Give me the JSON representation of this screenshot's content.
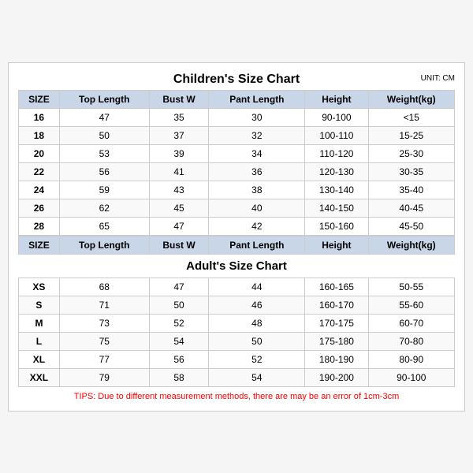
{
  "title": "Children's Size Chart",
  "unit": "UNIT: CM",
  "children_headers": [
    "SIZE",
    "Top Length",
    "Bust W",
    "Pant Length",
    "Height",
    "Weight(kg)"
  ],
  "children_rows": [
    [
      "16",
      "47",
      "35",
      "30",
      "90-100",
      "<15"
    ],
    [
      "18",
      "50",
      "37",
      "32",
      "100-110",
      "15-25"
    ],
    [
      "20",
      "53",
      "39",
      "34",
      "110-120",
      "25-30"
    ],
    [
      "22",
      "56",
      "41",
      "36",
      "120-130",
      "30-35"
    ],
    [
      "24",
      "59",
      "43",
      "38",
      "130-140",
      "35-40"
    ],
    [
      "26",
      "62",
      "45",
      "40",
      "140-150",
      "40-45"
    ],
    [
      "28",
      "65",
      "47",
      "42",
      "150-160",
      "45-50"
    ]
  ],
  "adults_title": "Adult's Size Chart",
  "adults_headers": [
    "SIZE",
    "Top Length",
    "Bust W",
    "Pant Length",
    "Height",
    "Weight(kg)"
  ],
  "adults_rows": [
    [
      "XS",
      "68",
      "47",
      "44",
      "160-165",
      "50-55"
    ],
    [
      "S",
      "71",
      "50",
      "46",
      "160-170",
      "55-60"
    ],
    [
      "M",
      "73",
      "52",
      "48",
      "170-175",
      "60-70"
    ],
    [
      "L",
      "75",
      "54",
      "50",
      "175-180",
      "70-80"
    ],
    [
      "XL",
      "77",
      "56",
      "52",
      "180-190",
      "80-90"
    ],
    [
      "XXL",
      "79",
      "58",
      "54",
      "190-200",
      "90-100"
    ]
  ],
  "tips": "TIPS: Due to different measurement methods, there are may be an error of 1cm-3cm"
}
